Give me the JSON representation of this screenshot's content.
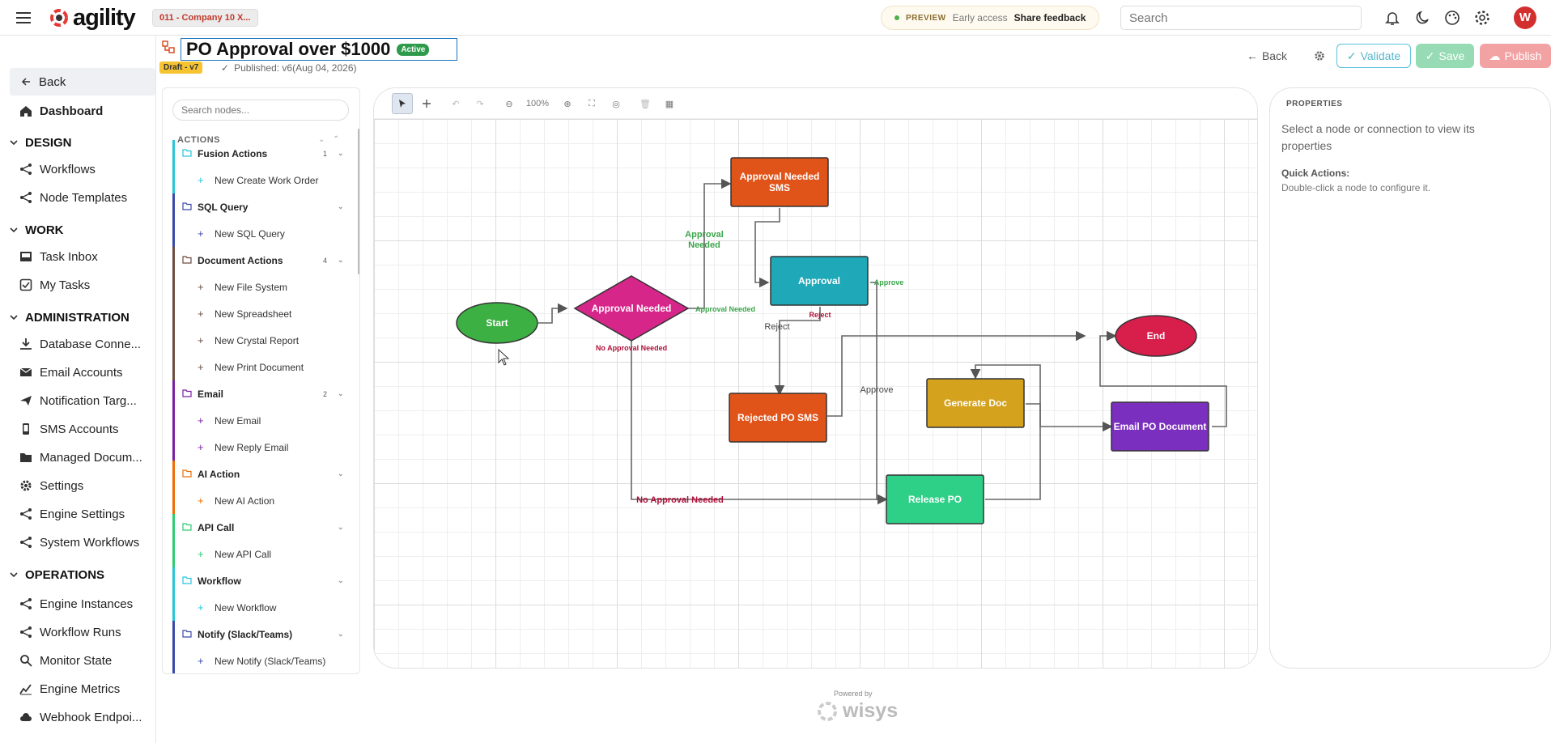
{
  "topbar": {
    "logo": "agility",
    "company": "011 - Company 10 X...",
    "preview_tag": "PREVIEW",
    "early_access": "Early access",
    "share_feedback": "Share feedback",
    "search_placeholder": "Search",
    "avatar_initial": "W"
  },
  "sidebar": {
    "back": "Back",
    "dashboard": "Dashboard",
    "sections": {
      "design": "DESIGN",
      "work": "WORK",
      "administration": "ADMINISTRATION",
      "operations": "OPERATIONS"
    },
    "design_items": [
      "Workflows",
      "Node Templates"
    ],
    "work_items": [
      "Task Inbox",
      "My Tasks"
    ],
    "admin_items": [
      "Database Conne...",
      "Email Accounts",
      "Notification Targ...",
      "SMS Accounts",
      "Managed Docum...",
      "Settings",
      "Engine Settings",
      "System Workflows"
    ],
    "ops_items": [
      "Engine Instances",
      "Workflow Runs",
      "Monitor State",
      "Engine Metrics",
      "Webhook Endpoi..."
    ]
  },
  "header": {
    "title": "PO Approval over $1000",
    "status": "Active",
    "draft": "Draft - v7",
    "published": "Published: v6(Aug 04, 2026)",
    "back": "Back",
    "validate": "Validate",
    "save": "Save",
    "publish": "Publish"
  },
  "palette": {
    "search_placeholder": "Search nodes...",
    "actions_label": "ACTIONS",
    "groups": [
      {
        "label": "Fusion Actions",
        "count": "1",
        "color": "#26c6da",
        "items": [
          "New Create Work Order"
        ]
      },
      {
        "label": "SQL Query",
        "count": "",
        "color": "#3949ab",
        "items": [
          "New SQL Query"
        ]
      },
      {
        "label": "Document Actions",
        "count": "4",
        "color": "#6d4c41",
        "items": [
          "New File System",
          "New Spreadsheet",
          "New Crystal Report",
          "New Print Document"
        ]
      },
      {
        "label": "Email",
        "count": "2",
        "color": "#7b1fa2",
        "items": [
          "New Email",
          "New Reply Email"
        ]
      },
      {
        "label": "AI Action",
        "count": "",
        "color": "#ef6c00",
        "items": [
          "New AI Action"
        ]
      },
      {
        "label": "API Call",
        "count": "",
        "color": "#2ecc71",
        "items": [
          "New API Call"
        ]
      },
      {
        "label": "Workflow",
        "count": "",
        "color": "#26c6da",
        "items": [
          "New Workflow"
        ]
      },
      {
        "label": "Notify (Slack/Teams)",
        "count": "",
        "color": "#3949ab",
        "items": [
          "New Notify (Slack/Teams)"
        ]
      }
    ]
  },
  "canvas": {
    "zoom": "100%",
    "nodes": {
      "start": "Start",
      "decision": "Approval Needed",
      "sms": [
        "Approval Needed",
        "SMS"
      ],
      "approval": "Approval",
      "rejected": "Rejected PO SMS",
      "generate": "Generate Doc",
      "release": "Release PO",
      "email": "Email PO Document",
      "end": "End"
    },
    "edges": {
      "approval_needed_top": [
        "Approval",
        "Needed"
      ],
      "approval_needed_right": "Approval Needed",
      "no_approval_needed": "No Approval Needed",
      "no_approval_needed_bottom": "No Approval Needed",
      "approve": "Approve",
      "approve_mid": "Approve",
      "reject_red": "Reject",
      "reject": "Reject"
    },
    "colors": {
      "start": "#3cb043",
      "decision": "#d6268a",
      "sms": "#e0541a",
      "approval": "#1fa8b8",
      "rejected": "#e0541a",
      "generate": "#d4a21c",
      "release": "#2ecf87",
      "email": "#7b2fbe",
      "end": "#d81e4a"
    }
  },
  "properties": {
    "title": "PROPERTIES",
    "hint": "Select a node or connection to view its properties",
    "quick_actions_label": "Quick Actions:",
    "quick_actions_text": "Double-click a node to configure it."
  },
  "footer": {
    "powered_by": "Powered by",
    "brand": "wisys"
  }
}
